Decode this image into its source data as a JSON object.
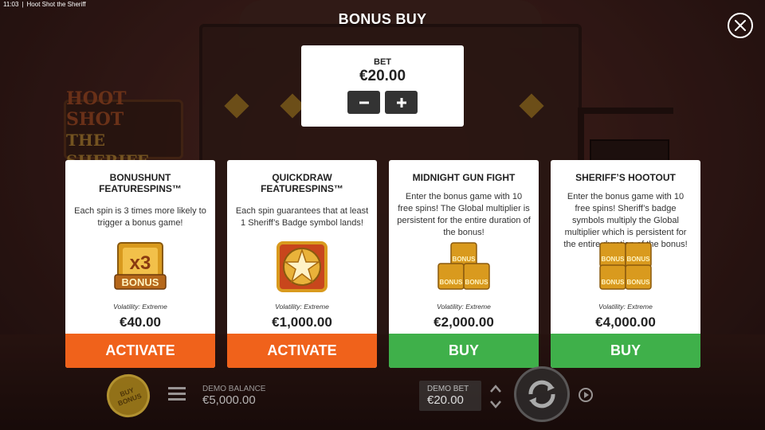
{
  "status_bar": {
    "time": "11:03",
    "app_title": "Hoot Shot the Sheriff"
  },
  "background": {
    "logo_line1": "HOOT SHOT",
    "logo_line2": "THE SHERIFF"
  },
  "modal": {
    "title": "BONUS BUY",
    "close_icon": "close-icon"
  },
  "bet": {
    "label": "BET",
    "value": "€20.00",
    "decrease_label": "−",
    "increase_label": "+"
  },
  "cards": [
    {
      "title": "BONUSHUNT FEATURESPINS™",
      "description": "Each spin is 3 times more likely to trigger a bonus game!",
      "icon": "bonus-x3-icon",
      "volatility": "Volatility: Extreme",
      "price": "€40.00",
      "action": "ACTIVATE",
      "action_color": "#f0621b"
    },
    {
      "title": "QUICKDRAW FEATURESPINS™",
      "description": "Each spin guarantees that at least 1 Sheriff’s Badge symbol lands!",
      "icon": "sheriff-badge-icon",
      "volatility": "Volatility: Extreme",
      "price": "€1,000.00",
      "action": "ACTIVATE",
      "action_color": "#f0621b"
    },
    {
      "title": "MIDNIGHT GUN FIGHT",
      "description": "Enter the bonus game with 10 free spins! The Global multiplier is persistent for the entire duration of the bonus!",
      "icon": "bonus-stack-3-icon",
      "volatility": "Volatility: Extreme",
      "price": "€2,000.00",
      "action": "BUY",
      "action_color": "#3fb04a"
    },
    {
      "title": "SHERIFF’S HOOTOUT",
      "description": "Enter the bonus game with 10 free spins! Sheriff’s badge symbols multiply the Global multiplier which is persistent for the entire duration of the bonus!",
      "icon": "bonus-stack-4-icon",
      "volatility": "Volatility: Extreme",
      "price": "€4,000.00",
      "action": "BUY",
      "action_color": "#3fb04a"
    }
  ],
  "bottom_bar": {
    "buy_bonus_label": "BUY BONUS",
    "balance_label": "DEMO BALANCE",
    "balance_value": "€5,000.00",
    "demo_bet_label": "DEMO BET",
    "demo_bet_value": "€20.00"
  },
  "colors": {
    "activate": "#f0621b",
    "buy": "#3fb04a",
    "gold": "#d99a1e"
  }
}
